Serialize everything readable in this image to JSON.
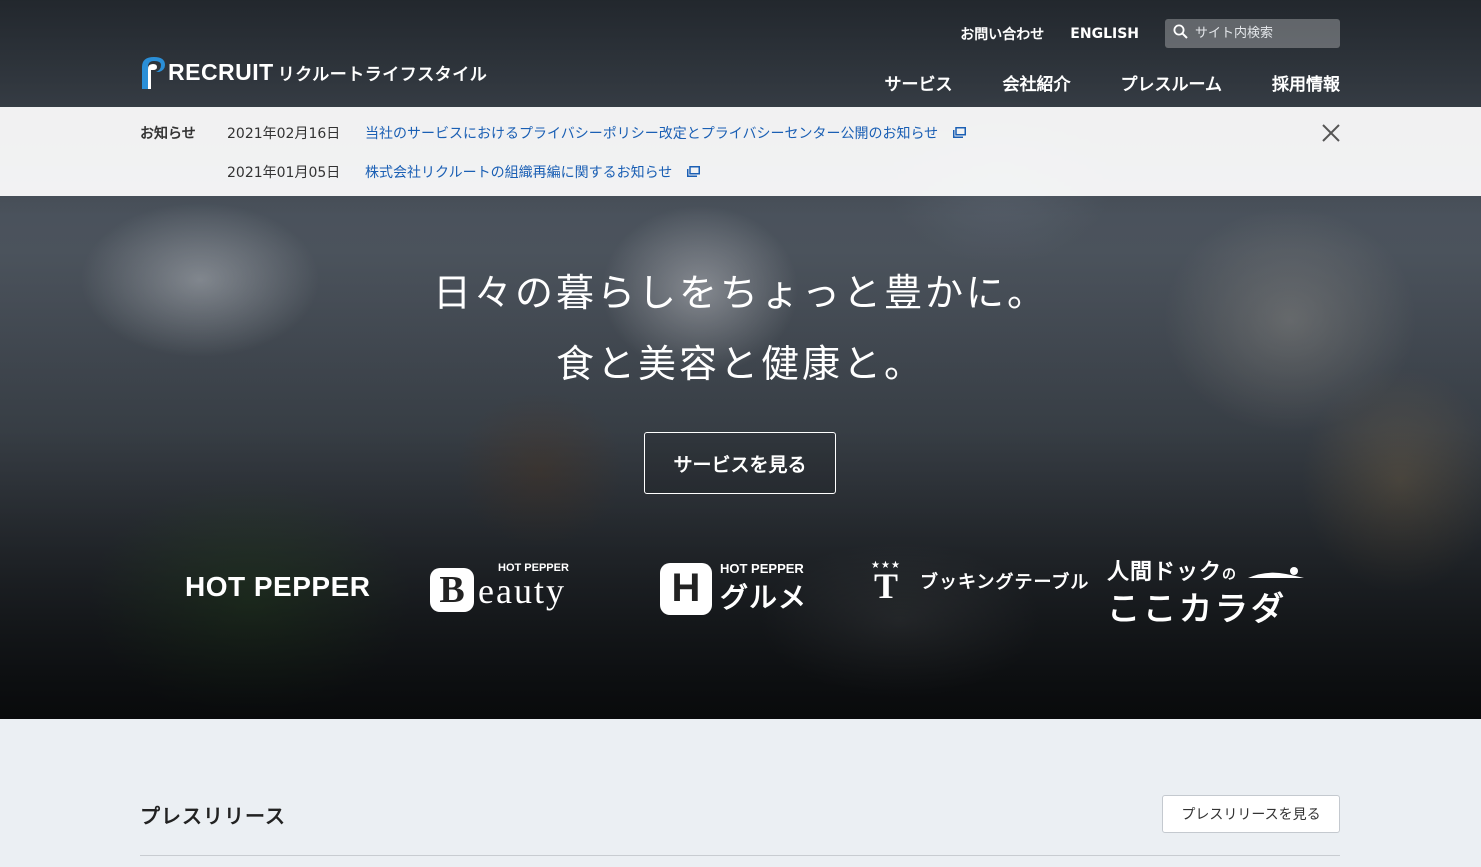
{
  "header": {
    "logo_text": "RECRUIT",
    "logo_kana": "リクルートライフスタイル",
    "util_links": [
      "お問い合わせ",
      "ENGLISH"
    ],
    "search_placeholder": "サイト内検索",
    "nav": [
      "サービス",
      "会社紹介",
      "プレスルーム",
      "採用情報"
    ]
  },
  "notice": {
    "title": "お知らせ",
    "items": [
      {
        "date": "2021年02月16日",
        "text": "当社のサービスにおけるプライバシーポリシー改定とプライバシーセンター公開のお知らせ"
      },
      {
        "date": "2021年01月05日",
        "text": "株式会社リクルートの組織再編に関するお知らせ"
      }
    ]
  },
  "hero": {
    "line1": "日々の暮らしをちょっと豊かに。",
    "line2": "食と美容と健康と。",
    "cta": "サービスを見る"
  },
  "brands": {
    "hotpepper": "HOT PEPPER",
    "beauty_small": "HOT PEPPER",
    "beauty_mark": "B",
    "beauty_big": "eauty",
    "gourmet_small": "HOT PEPPER",
    "gourmet_mark": "H",
    "gourmet_big": "グルメ",
    "booking_stars": "★★★",
    "booking_mark": "T",
    "booking_name": "ブッキングテーブル",
    "ningen_top": "人間ドック",
    "ningen_no": "の",
    "ningen_bottom": "ここカラダ"
  },
  "press": {
    "title": "プレスリリース",
    "button": "プレスリリースを見る"
  },
  "colors": {
    "link": "#1a5fb4",
    "logo_blue": "#2a8fd8",
    "section_bg": "#ebeff3"
  }
}
